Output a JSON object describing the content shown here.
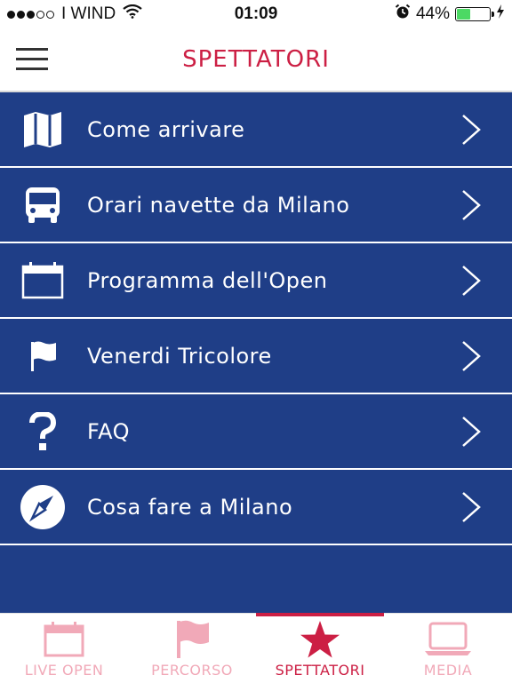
{
  "status_bar": {
    "carrier": "I WIND",
    "time": "01:09",
    "battery_percent": "44%",
    "battery_level": 0.44
  },
  "header": {
    "title": "SPETTATORI"
  },
  "menu": {
    "items": [
      {
        "label": "Come arrivare",
        "icon": "map-icon"
      },
      {
        "label": "Orari navette da Milano",
        "icon": "bus-icon"
      },
      {
        "label": "Programma dell'Open",
        "icon": "calendar-icon"
      },
      {
        "label": "Venerdi Tricolore",
        "icon": "flag-icon"
      },
      {
        "label": "FAQ",
        "icon": "question-icon"
      },
      {
        "label": "Cosa fare a Milano",
        "icon": "compass-icon"
      }
    ]
  },
  "tabbar": {
    "tabs": [
      {
        "label": "LIVE OPEN",
        "icon": "calendar-icon",
        "active": false
      },
      {
        "label": "PERCORSO",
        "icon": "flag-icon",
        "active": false
      },
      {
        "label": "SPETTATORI",
        "icon": "star-icon",
        "active": true
      },
      {
        "label": "MEDIA",
        "icon": "laptop-icon",
        "active": false
      }
    ]
  },
  "colors": {
    "accent": "#cc1f44",
    "menu_background": "#1f3e87",
    "inactive_tab": "#f1a9b8"
  }
}
